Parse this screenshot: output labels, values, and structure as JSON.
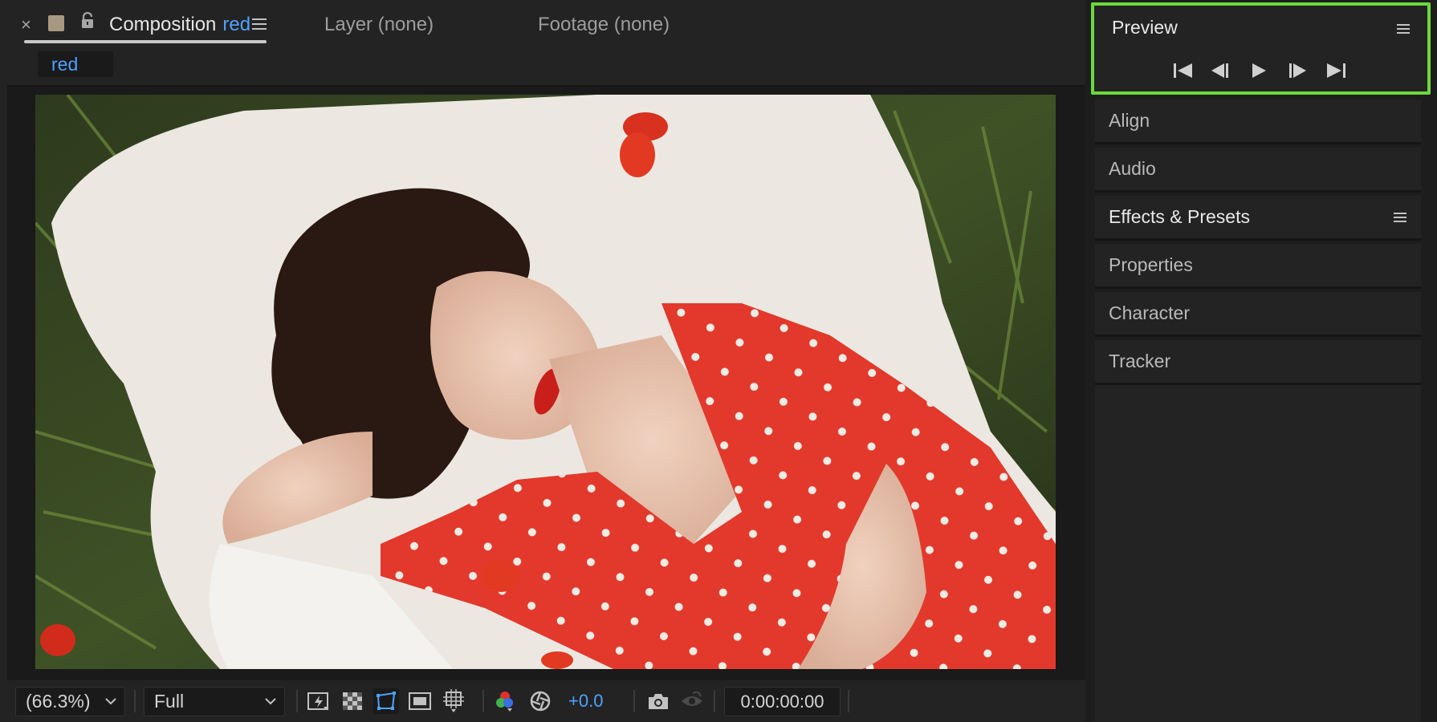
{
  "colors": {
    "accent": "#4ea2ff",
    "preview_highlight": "#6dd83c",
    "comp_swatch": "#a79981"
  },
  "comp_panel": {
    "close_glyph": "×",
    "tab_title": "Composition",
    "comp_name": "red",
    "layer_tab": "Layer (none)",
    "footage_tab": "Footage (none)",
    "nav_comp": "red",
    "icons": [
      "close-icon",
      "comp-color-swatch",
      "lock-icon",
      "panel-menu-icon"
    ]
  },
  "toolbar": {
    "zoom": "(66.3%)",
    "resolution": "Full",
    "exposure": "+0.0",
    "timecode": "0:00:00:00",
    "icons": [
      "fast-previews-icon",
      "transparency-grid-icon",
      "mask-path-icon",
      "region-of-interest-icon",
      "grid-guides-icon",
      "color-channels-icon",
      "reset-exposure-icon",
      "snapshot-camera-icon",
      "show-snapshot-icon"
    ]
  },
  "right_panels": {
    "preview": {
      "title": "Preview",
      "controls": [
        "first-frame-icon",
        "previous-frame-icon",
        "play-icon",
        "next-frame-icon",
        "last-frame-icon"
      ]
    },
    "panels": [
      {
        "label": "Align"
      },
      {
        "label": "Audio"
      },
      {
        "label": "Effects & Presets"
      },
      {
        "label": "Properties"
      },
      {
        "label": "Character"
      },
      {
        "label": "Tracker"
      }
    ]
  }
}
